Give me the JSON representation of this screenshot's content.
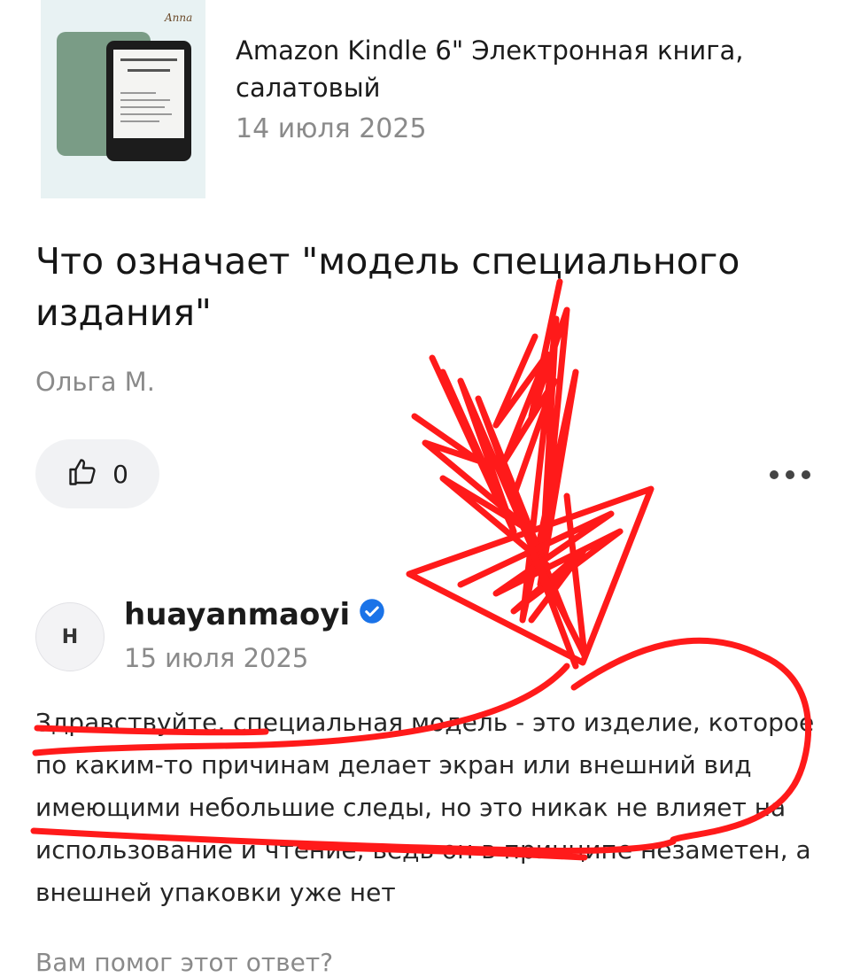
{
  "product": {
    "title": "Amazon Kindle 6\" Электронная книга, салатовый",
    "date": "14 июля 2025",
    "thumb_brand": "Anna"
  },
  "question": {
    "title": "Что означает \"модель специального издания\"",
    "author": "Ольга М.",
    "likes": "0"
  },
  "answer": {
    "avatar_letter": "H",
    "username": "huayanmaoyi",
    "verified": true,
    "date": "15 июля 2025",
    "text": "Здравствуйте, специальная модель - это изделие, которое по каким-то причинам делает экран или внешний вид имеющими небольшие следы, но это никак не влияет на использование и чтение, ведь он в принципе незаметен, а внешней упаковки уже нет"
  },
  "helpful_prompt": "Вам помог этот ответ?",
  "colors": {
    "annotation": "#ff1a1a",
    "muted_text": "#8a8a8a",
    "verified_badge": "#1a73e8"
  }
}
